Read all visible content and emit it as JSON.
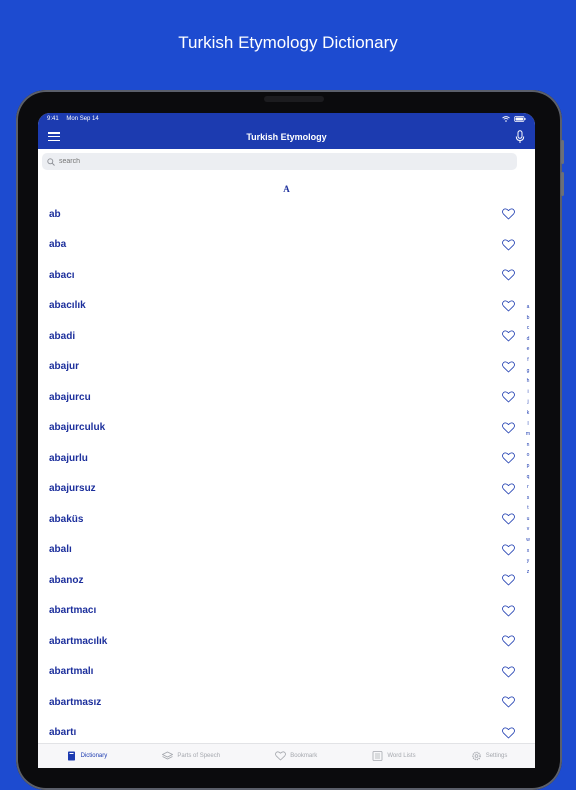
{
  "headline": "Turkish Etymology Dictionary",
  "status": {
    "time": "9:41",
    "date": "Mon Sep 14"
  },
  "nav": {
    "title": "Turkish Etymology"
  },
  "search": {
    "placeholder": "search"
  },
  "section": "A",
  "words": [
    "ab",
    "aba",
    "abacı",
    "abacılık",
    "abadi",
    "abajur",
    "abajurcu",
    "abajurculuk",
    "abajurlu",
    "abajursuz",
    "abaküs",
    "abalı",
    "abanoz",
    "abartmacı",
    "abartmacılık",
    "abartmalı",
    "abartmasız",
    "abartı"
  ],
  "alphabet": [
    "a",
    "b",
    "c",
    "d",
    "e",
    "f",
    "g",
    "h",
    "i",
    "j",
    "k",
    "l",
    "m",
    "n",
    "o",
    "p",
    "q",
    "r",
    "s",
    "t",
    "u",
    "v",
    "w",
    "x",
    "y",
    "z"
  ],
  "tabs": [
    {
      "label": "Dictionary",
      "icon": "book-icon",
      "active": true
    },
    {
      "label": "Parts of Speech",
      "icon": "layers-icon",
      "active": false
    },
    {
      "label": "Bookmark",
      "icon": "heart-icon",
      "active": false
    },
    {
      "label": "Word Lists",
      "icon": "list-icon",
      "active": false
    },
    {
      "label": "Settings",
      "icon": "gear-icon",
      "active": false
    }
  ],
  "colors": {
    "background": "#1d4bd0",
    "navbar": "#1c3bb0",
    "accent": "#1c2f9c"
  }
}
